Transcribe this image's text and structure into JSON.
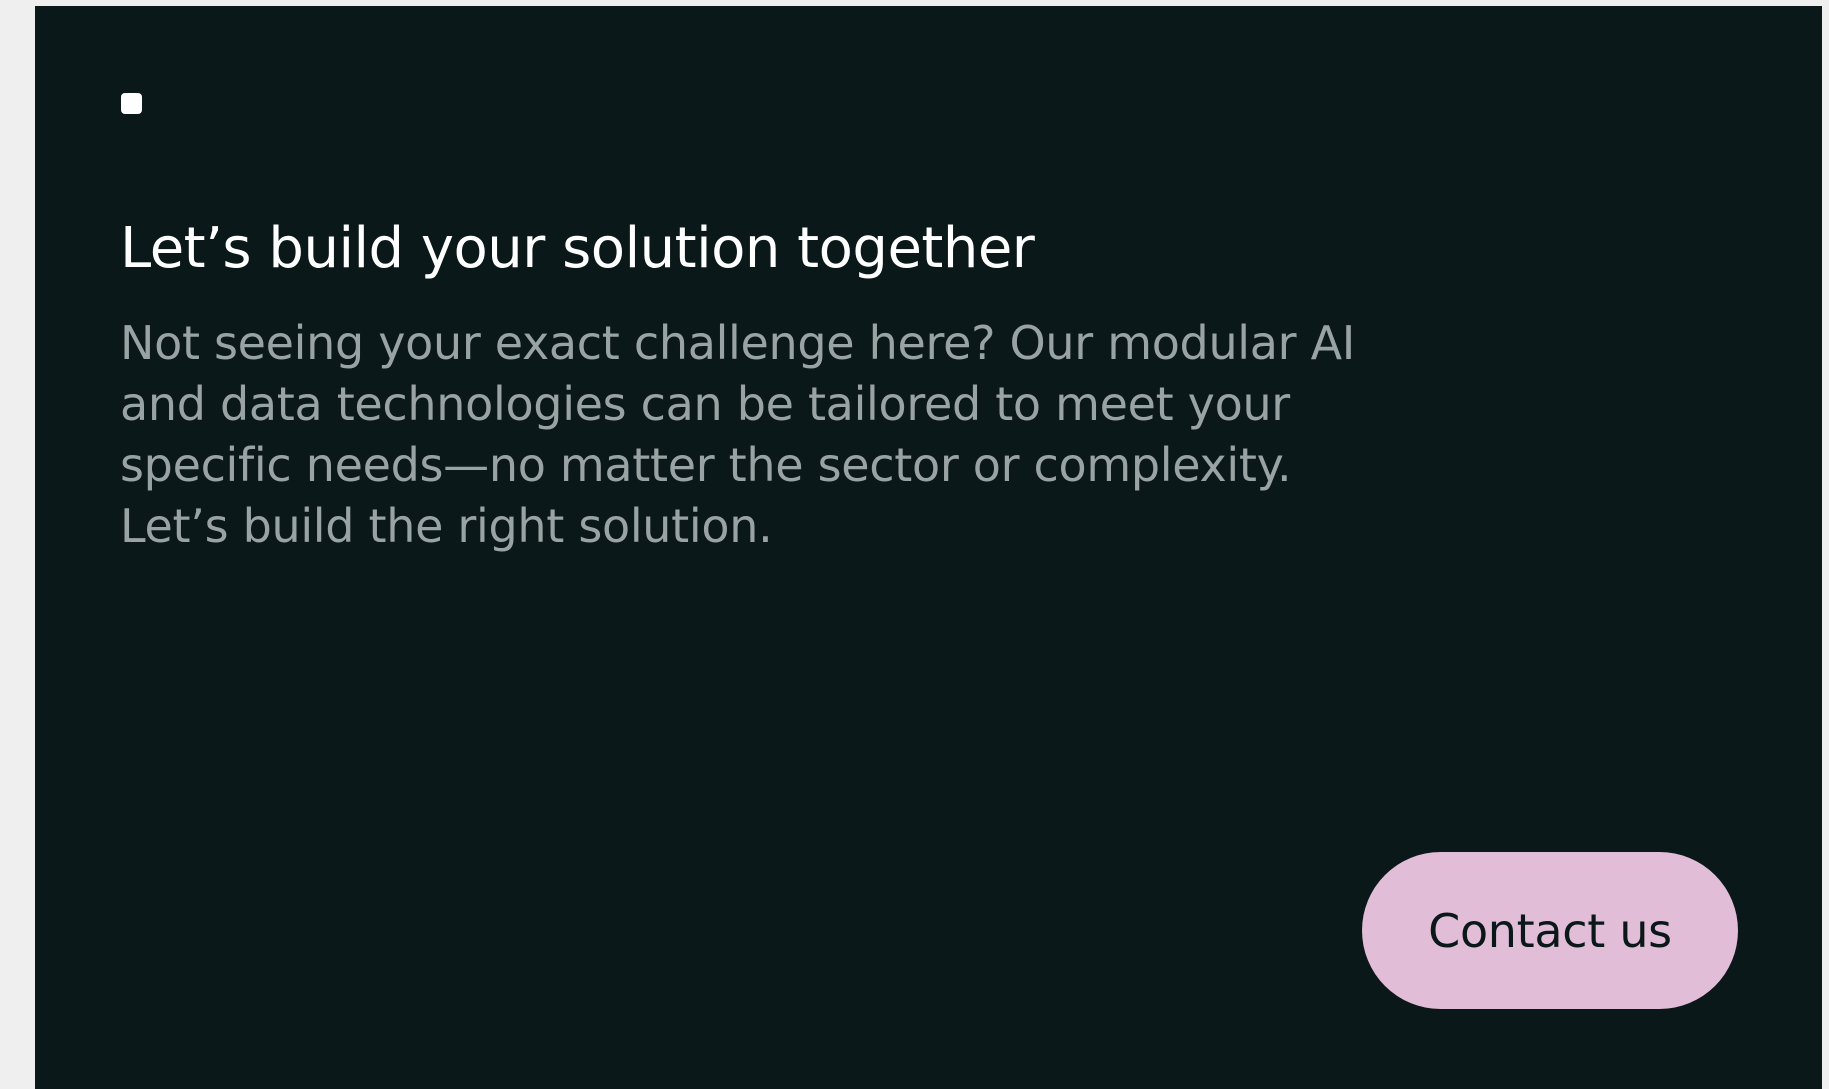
{
  "cta_section": {
    "bullet_icon": "square-bullet-icon",
    "heading": "Let’s build your solution together",
    "description": "Not seeing your exact challenge here? Our modular AI and data technologies can be tailored to meet your specific needs—no matter the sector or complexity. Let’s build the right solution.",
    "contact_button_label": "Contact us"
  },
  "colors": {
    "card_background": "#0a1819",
    "page_background": "#eeefee",
    "heading_text": "#ffffff",
    "body_text": "#9aa3a3",
    "button_background": "#e1bdd7",
    "button_text": "#0a1819"
  }
}
